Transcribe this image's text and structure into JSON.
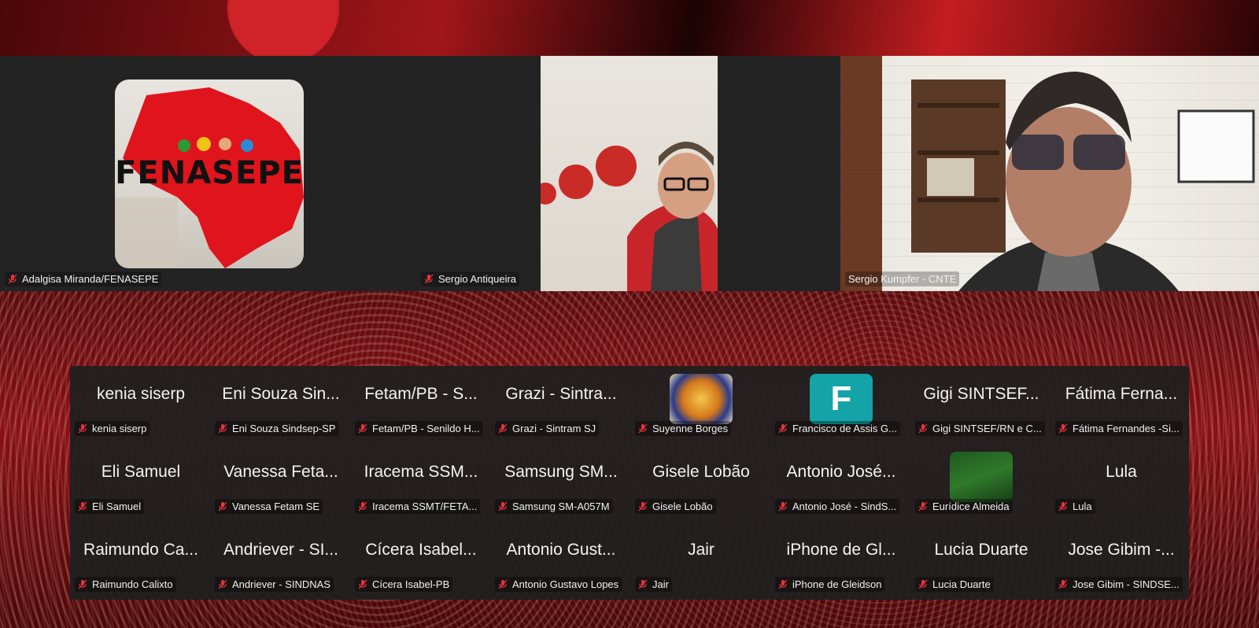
{
  "stage": {
    "tiles": [
      {
        "name": "Adalgisa Miranda/FENASEPE",
        "logo_text": "FENASEPE",
        "muted": true
      },
      {
        "name": "Sergio Antiqueira",
        "muted": true
      },
      {
        "name": "Sergio Kumpfer - CNTE",
        "muted": false,
        "active_speaker": true
      }
    ]
  },
  "gallery": {
    "rows": [
      [
        {
          "display": "kenia siserp",
          "label": "kenia siserp"
        },
        {
          "display": "Eni Souza Sin...",
          "label": "Eni Souza Sindsep-SP"
        },
        {
          "display": "Fetam/PB - S...",
          "label": "Fetam/PB - Senildo H..."
        },
        {
          "display": "Grazi - Sintra...",
          "label": "Grazi - Sintram SJ"
        },
        {
          "display": "",
          "label": "Suyenne Borges",
          "avatar": "sb"
        },
        {
          "display": "",
          "label": "Francisco de Assis G...",
          "avatar": "f",
          "avatar_letter": "F"
        },
        {
          "display": "Gigi SINTSEF...",
          "label": "Gigi SINTSEF/RN e C..."
        },
        {
          "display": "Fátima Ferna...",
          "label": "Fátima Fernandes -Si..."
        }
      ],
      [
        {
          "display": "Eli Samuel",
          "label": "Eli Samuel"
        },
        {
          "display": "Vanessa Feta...",
          "label": "Vanessa Fetam SE"
        },
        {
          "display": "Iracema SSM...",
          "label": "Iracema SSMT/FETA..."
        },
        {
          "display": "Samsung SM...",
          "label": "Samsung SM-A057M"
        },
        {
          "display": "Gisele Lobão",
          "label": "Gisele Lobão"
        },
        {
          "display": "Antonio José...",
          "label": "Antonio José - SindS..."
        },
        {
          "display": "",
          "label": "Eurídice Almeida",
          "avatar": "ea"
        },
        {
          "display": "Lula",
          "label": "Lula"
        }
      ],
      [
        {
          "display": "Raimundo Ca...",
          "label": "Raimundo Calixto"
        },
        {
          "display": "Andriever - SI...",
          "label": "Andriever - SINDNAS"
        },
        {
          "display": "Cícera Isabel...",
          "label": "Cícera Isabel-PB"
        },
        {
          "display": "Antonio Gust...",
          "label": "Antonio Gustavo Lopes"
        },
        {
          "display": "Jair",
          "label": "Jair"
        },
        {
          "display": "iPhone de Gl...",
          "label": "iPhone de Gleidson"
        },
        {
          "display": "Lucia Duarte",
          "label": "Lucia Duarte"
        },
        {
          "display": "Jose Gibim -...",
          "label": "Jose Gibim - SINDSE..."
        }
      ]
    ]
  },
  "colors": {
    "active_border": "#43d24c",
    "muted_icon": "#e8333a",
    "tile_bg": "#232323",
    "avatar_teal": "#14a3a7"
  },
  "icons": {
    "muted": "mic-muted-icon"
  }
}
